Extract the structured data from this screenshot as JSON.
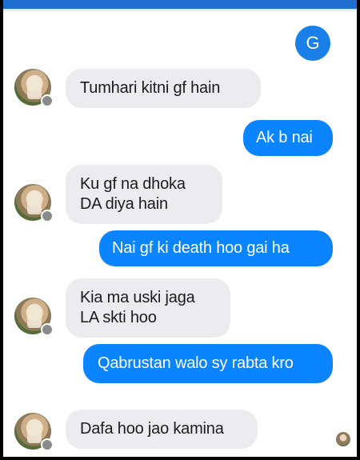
{
  "header": {
    "accent_color": "#1f6fd1"
  },
  "sender_avatar": {
    "initial": "G",
    "color": "#1a7fe8"
  },
  "messages": [
    {
      "direction": "incoming",
      "text": "Tumhari kitni gf hain"
    },
    {
      "direction": "outgoing",
      "text": "Ak b nai"
    },
    {
      "direction": "incoming",
      "text": "Ku gf na dhoka DA diya hain"
    },
    {
      "direction": "outgoing",
      "text": "Nai gf ki death hoo gai ha"
    },
    {
      "direction": "incoming",
      "text": "Kia ma uski jaga LA skti hoo"
    },
    {
      "direction": "outgoing",
      "text": "Qabrustan walo sy rabta kro"
    },
    {
      "direction": "incoming",
      "text": "Dafa hoo jao kamina"
    }
  ],
  "colors": {
    "incoming_bubble": "#ececee",
    "outgoing_bubble": "#0b84ff"
  }
}
